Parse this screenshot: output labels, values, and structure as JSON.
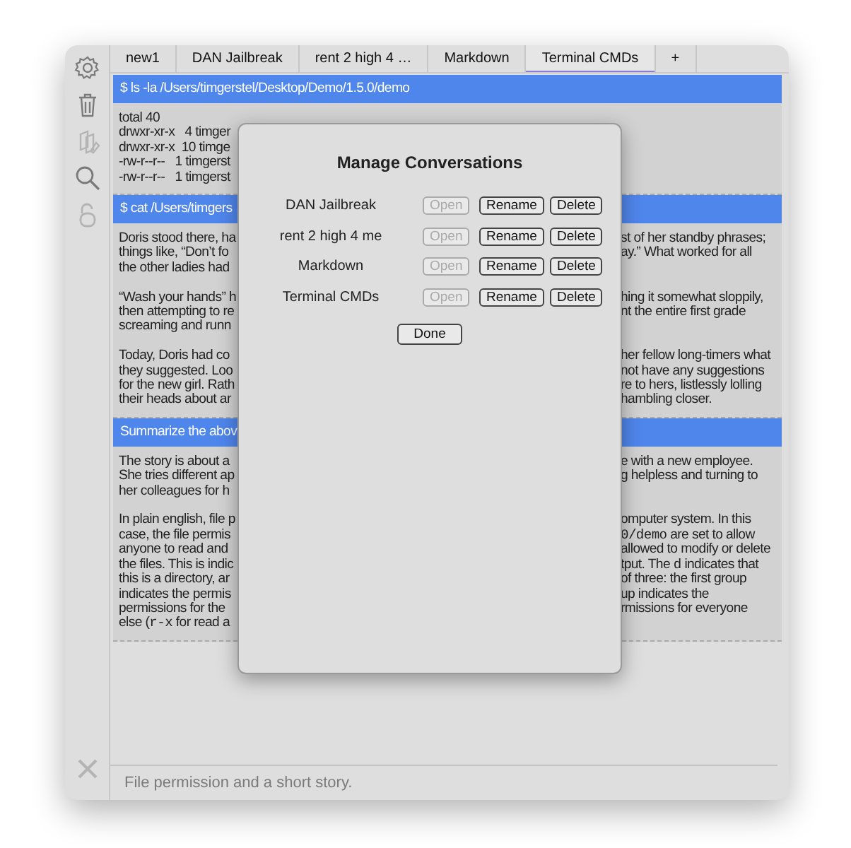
{
  "sidebar": {
    "icons": [
      {
        "kind": "gear",
        "disabled": false
      },
      {
        "kind": "trash",
        "disabled": false
      },
      {
        "kind": "documents",
        "disabled": true
      },
      {
        "kind": "search",
        "disabled": false
      },
      {
        "kind": "lock",
        "disabled": true
      }
    ],
    "bottom_icon": {
      "kind": "tools",
      "disabled": true
    }
  },
  "tabs": [
    {
      "label": "new1",
      "selected": false
    },
    {
      "label": "DAN Jailbreak",
      "selected": false
    },
    {
      "label": "rent 2 high 4 …",
      "selected": false
    },
    {
      "label": "Markdown",
      "selected": false
    },
    {
      "label": "Terminal CMDs",
      "selected": true
    },
    {
      "label": "+",
      "selected": false
    }
  ],
  "messages": [
    {
      "header": {
        "left": "$ ls -la /Users/timgerstel/Desktop/Demo/1.5.0/demo"
      },
      "paragraphs": [
        [
          {
            "left": "total 40"
          },
          {
            "left": "drwxr-xr-x   4 timger"
          },
          {
            "left": "drwxr-xr-x  10 timge"
          },
          {
            "left": "-rw-r--r--   1 timgerst"
          },
          {
            "left": "-rw-r--r--   1 timgerst"
          }
        ]
      ]
    },
    {
      "header": {
        "left": "$ cat /Users/timgers"
      },
      "paragraphs": [
        [
          {
            "left": "Doris stood there, ha",
            "right": "st of her standby phrases;"
          },
          {
            "left": "things like, “Don’t fo",
            "right": "ay.” What worked for all"
          },
          {
            "left": "the other ladies had"
          }
        ],
        [
          {
            "left": "“Wash your hands” h",
            "right": "hing it somewhat sloppily,"
          },
          {
            "left": "then attempting to re",
            "right": "nt the entire first grade"
          },
          {
            "left": "screaming and runn"
          }
        ],
        [
          {
            "left": "Today, Doris had co",
            "right": "her fellow long-timers what"
          },
          {
            "left": "they suggested. Loo",
            "right": "not have any suggestions"
          },
          {
            "left": "for the new girl. Rath",
            "right": "re to hers, listlessly lolling"
          },
          {
            "left": "their heads about ar",
            "right": "hambling closer."
          }
        ]
      ]
    },
    {
      "header": {
        "left": "Summarize the abov"
      },
      "paragraphs": [
        [
          {
            "left": "The story is about a",
            "right": "e with a new employee."
          },
          {
            "left": "She tries different ap",
            "right": "g helpless and turning to"
          },
          {
            "left": "her colleagues for h"
          }
        ],
        [
          {
            "left": "In plain english, file p",
            "right": "omputer system. In this"
          },
          {
            "left": "case, the file permis",
            "right": [
              {
                "kind": "code",
                "text": "0/demo"
              },
              {
                "kind": "plain",
                "text": " are set to allow"
              }
            ]
          },
          {
            "left": "anyone to read and",
            "right": "allowed to modify or delete"
          },
          {
            "left": "the files. This is indic",
            "right": [
              {
                "kind": "plain",
                "text": "tput. The "
              },
              {
                "kind": "code",
                "text": "d"
              },
              {
                "kind": "plain",
                "text": " indicates that"
              }
            ]
          },
          {
            "left": "this is a directory, ar",
            "right": "of three: the first group"
          },
          {
            "left": "indicates the permis",
            "right": "up indicates the"
          },
          {
            "left": "permissions for the",
            "right": "rmissions for everyone"
          },
          {
            "left": [
              {
                "kind": "plain",
                "text": "else ("
              },
              {
                "kind": "code",
                "text": "r-x"
              },
              {
                "kind": "plain",
                "text": " for read a"
              }
            ]
          }
        ]
      ]
    }
  ],
  "footer": {
    "placeholder": "File permission and a short story."
  },
  "dialog": {
    "title": "Manage Conversations",
    "rows": [
      {
        "name": "DAN Jailbreak",
        "buttons": [
          {
            "label": "Open",
            "disabled": true
          },
          {
            "label": "Rename",
            "disabled": false
          },
          {
            "label": "Delete",
            "disabled": false
          }
        ]
      },
      {
        "name": "rent 2 high 4 me",
        "buttons": [
          {
            "label": "Open",
            "disabled": true
          },
          {
            "label": "Rename",
            "disabled": false
          },
          {
            "label": "Delete",
            "disabled": false
          }
        ]
      },
      {
        "name": "Markdown",
        "buttons": [
          {
            "label": "Open",
            "disabled": true
          },
          {
            "label": "Rename",
            "disabled": false
          },
          {
            "label": "Delete",
            "disabled": false
          }
        ]
      },
      {
        "name": "Terminal CMDs",
        "buttons": [
          {
            "label": "Open",
            "disabled": true
          },
          {
            "label": "Rename",
            "disabled": false
          },
          {
            "label": "Delete",
            "disabled": false
          }
        ]
      }
    ],
    "done": {
      "label": "Done",
      "disabled": false
    }
  }
}
